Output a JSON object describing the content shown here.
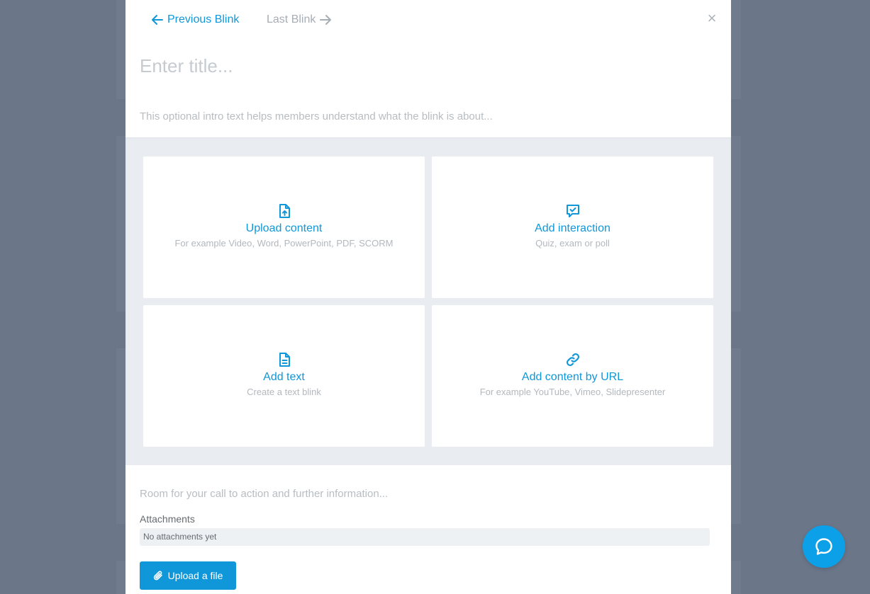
{
  "nav": {
    "previous_label": "Previous Blink",
    "next_label": "Last Blink",
    "close_symbol": "×"
  },
  "editor": {
    "title_placeholder": "Enter title...",
    "intro_placeholder": "This optional intro text helps members understand what the blink is about...",
    "cta_placeholder": "Room for your call to action and further information..."
  },
  "content_options": [
    {
      "icon": "file-upload-icon",
      "title": "Upload content",
      "subtitle": "For example Video, Word, PowerPoint, PDF, SCORM"
    },
    {
      "icon": "message-check-icon",
      "title": "Add interaction",
      "subtitle": "Quiz, exam or poll"
    },
    {
      "icon": "file-text-icon",
      "title": "Add text",
      "subtitle": "Create a text blink"
    },
    {
      "icon": "link-icon",
      "title": "Add content by URL",
      "subtitle": "For example YouTube, Vimeo, Slidepresenter"
    }
  ],
  "attachments": {
    "label": "Attachments",
    "empty_text": "No attachments yet",
    "upload_label": "Upload a file"
  },
  "colors": {
    "accent": "#0f97d9",
    "muted": "#a7adb4",
    "overlay": "#6b7689",
    "content_bg": "#e9edf1"
  }
}
